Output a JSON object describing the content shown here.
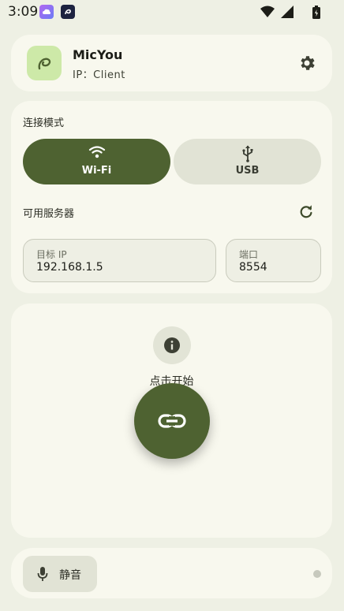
{
  "status_bar": {
    "time": "3:09"
  },
  "header": {
    "app_name": "MicYou",
    "subtitle": "IP：Client"
  },
  "connection": {
    "mode_label": "连接模式",
    "modes": [
      {
        "label": "Wi-Fi",
        "icon": "wifi-icon",
        "selected": true
      },
      {
        "label": "USB",
        "icon": "usb-icon",
        "selected": false
      }
    ],
    "servers_label": "可用服务器",
    "ip_field": {
      "label": "目标 IP",
      "value": "192.168.1.5"
    },
    "port_field": {
      "label": "端口",
      "value": "8554"
    }
  },
  "main": {
    "hint": "点击开始"
  },
  "bottom": {
    "mute_label": "静音"
  },
  "colors": {
    "background": "#eef0e4",
    "card": "#f8f8ee",
    "accent": "#4e6231",
    "app_icon_bg": "#cde9a8",
    "tonal": "#e1e3d5"
  }
}
